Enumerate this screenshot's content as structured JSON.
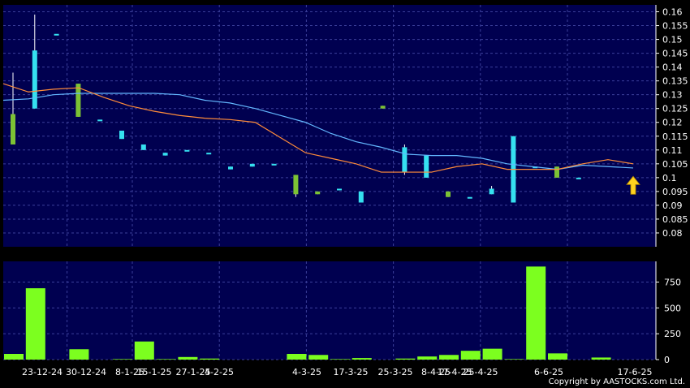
{
  "chart_data": [
    {
      "type": "candlestick",
      "title": "",
      "ylim": [
        0.08,
        0.16
      ],
      "y_ticks": [
        0.16,
        0.155,
        0.15,
        0.145,
        0.14,
        0.135,
        0.13,
        0.125,
        0.12,
        0.115,
        0.11,
        0.105,
        0.1,
        0.095,
        0.09,
        0.085,
        0.08
      ],
      "y_tick_labels": [
        "0.16",
        "0.155",
        "0.15",
        "0.145",
        "0.14",
        "0.135",
        "0.13",
        "0.125",
        "0.12",
        "0.115",
        "0.11",
        "0.105",
        "0.1",
        "0.095",
        "0.09",
        "0.085",
        "0.08"
      ],
      "grid": true,
      "candles": [
        {
          "open": 0.123,
          "close": 0.112,
          "high": 0.138,
          "low": 0.112
        },
        {
          "open": 0.125,
          "close": 0.146,
          "high": 0.159,
          "low": 0.125
        },
        {
          "open": 0.152,
          "close": 0.152,
          "high": 0.152,
          "low": 0.152
        },
        {
          "open": 0.134,
          "close": 0.122,
          "high": 0.134,
          "low": 0.122
        },
        {
          "open": 0.121,
          "close": 0.121,
          "high": 0.121,
          "low": 0.121
        },
        {
          "open": 0.114,
          "close": 0.117,
          "high": 0.117,
          "low": 0.114
        },
        {
          "open": 0.11,
          "close": 0.112,
          "high": 0.112,
          "low": 0.11
        },
        {
          "open": 0.108,
          "close": 0.109,
          "high": 0.109,
          "low": 0.108
        },
        {
          "open": 0.11,
          "close": 0.11,
          "high": 0.11,
          "low": 0.11
        },
        {
          "open": 0.109,
          "close": 0.109,
          "high": 0.109,
          "low": 0.109
        },
        {
          "open": 0.103,
          "close": 0.104,
          "high": 0.104,
          "low": 0.103
        },
        {
          "open": 0.104,
          "close": 0.105,
          "high": 0.105,
          "low": 0.104
        },
        {
          "open": 0.105,
          "close": 0.105,
          "high": 0.105,
          "low": 0.105
        },
        {
          "open": 0.101,
          "close": 0.094,
          "high": 0.101,
          "low": 0.093
        },
        {
          "open": 0.095,
          "close": 0.094,
          "high": 0.095,
          "low": 0.094
        },
        {
          "open": 0.096,
          "close": 0.096,
          "high": 0.096,
          "low": 0.096
        },
        {
          "open": 0.091,
          "close": 0.095,
          "high": 0.095,
          "low": 0.091
        },
        {
          "open": 0.126,
          "close": 0.125,
          "high": 0.126,
          "low": 0.125
        },
        {
          "open": 0.102,
          "close": 0.111,
          "high": 0.112,
          "low": 0.101
        },
        {
          "open": 0.1,
          "close": 0.108,
          "high": 0.108,
          "low": 0.1
        },
        {
          "open": 0.095,
          "close": 0.093,
          "high": 0.095,
          "low": 0.093
        },
        {
          "open": 0.093,
          "close": 0.093,
          "high": 0.093,
          "low": 0.093
        },
        {
          "open": 0.094,
          "close": 0.096,
          "high": 0.097,
          "low": 0.094
        },
        {
          "open": 0.091,
          "close": 0.115,
          "high": 0.115,
          "low": 0.091
        },
        {
          "open": 0.104,
          "close": 0.104,
          "high": 0.104,
          "low": 0.104
        },
        {
          "open": 0.104,
          "close": 0.1,
          "high": 0.104,
          "low": 0.1
        },
        {
          "open": 0.1,
          "close": 0.1,
          "high": 0.1,
          "low": 0.1
        }
      ],
      "candle_x_index": [
        0,
        1,
        2,
        3,
        4,
        5,
        6,
        7,
        8,
        9,
        10,
        11,
        12,
        13,
        14,
        15,
        16,
        17,
        18,
        19,
        20,
        21,
        22,
        23,
        24,
        25,
        26
      ],
      "series": [
        {
          "values": [
            0.128,
            0.1285,
            0.13,
            0.1305,
            0.1305,
            0.1305,
            0.1305,
            0.13,
            0.128,
            0.127,
            0.125,
            0.1225,
            0.12,
            0.116,
            0.113,
            0.111,
            0.1085,
            0.108,
            0.108,
            0.107,
            0.105,
            0.104,
            0.103,
            0.1045,
            0.104,
            0.1035
          ],
          "color": "#63b8ff"
        },
        {
          "values": [
            0.134,
            0.131,
            0.132,
            0.1325,
            0.129,
            0.126,
            0.124,
            0.1225,
            0.1215,
            0.121,
            0.12,
            0.1145,
            0.109,
            0.107,
            0.105,
            0.102,
            0.102,
            0.102,
            0.104,
            0.105,
            0.103,
            0.103,
            0.103,
            0.105,
            0.1065,
            0.105
          ],
          "color": "#ff8c3a"
        }
      ],
      "line_x_index": [
        0,
        1,
        2,
        3,
        4,
        5,
        6,
        7,
        8,
        9,
        10,
        11,
        12,
        13,
        14,
        15,
        16,
        17,
        18,
        19,
        20,
        21,
        22,
        23,
        24,
        25
      ],
      "up_color": "#35e0f0",
      "down_color": "#7cc234",
      "marker": {
        "type": "arrow",
        "value": 0.094,
        "color": "#ffd21f"
      }
    },
    {
      "type": "bar",
      "title": "",
      "ylim": [
        0,
        950
      ],
      "y_ticks": [
        0,
        250,
        500,
        750
      ],
      "y_tick_labels": [
        "0",
        "250",
        "500",
        "750"
      ],
      "categories": [
        "23-12-24",
        "30-12-24",
        "8-1-25",
        "15-1-25",
        "27-1-25",
        "4-2-25",
        "4-3-25",
        "17-3-25",
        "25-3-25",
        "8-4-25",
        "17-4-25",
        "25-4-25",
        "6-6-25",
        "17-6-25"
      ],
      "bar_values": [
        55,
        690,
        0,
        100,
        0,
        5,
        175,
        5,
        25,
        10,
        0,
        0,
        0,
        55,
        45,
        5,
        15,
        0,
        10,
        30,
        45,
        85,
        105,
        5,
        900,
        60,
        0,
        20,
        0
      ],
      "bar_x_index": [
        0,
        1,
        2,
        3,
        4,
        5,
        6,
        7,
        8,
        9,
        10,
        11,
        12,
        13,
        14,
        15,
        16,
        17,
        18,
        19,
        20,
        21,
        22,
        23,
        24,
        25,
        26,
        27,
        28
      ],
      "bar_color": "#7cff1f"
    }
  ],
  "x_tick_labels": [
    "23-12-24",
    "30-12-24",
    "8-1-25",
    "15-1-25",
    "27-1-25",
    "4-2-25",
    "4-3-25",
    "17-3-25",
    "25-3-25",
    "8-4-25",
    "17-4-25",
    "25-4-25",
    "6-6-25",
    "17-6-25"
  ],
  "colors": {
    "plot_bg": "#000050",
    "grid": "#3b3f9a",
    "axis_text": "#ffffff",
    "page_bg": "#000000"
  },
  "copyright": "Copyright by AASTOCKS.com Ltd."
}
